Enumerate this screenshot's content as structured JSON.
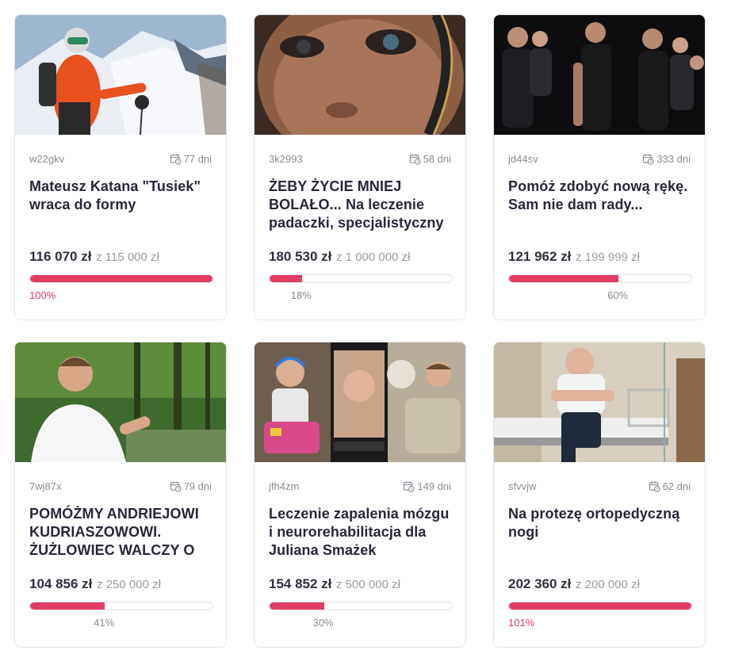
{
  "colors": {
    "accent": "#e23c63",
    "text": "#27273a",
    "muted": "#8a8a96"
  },
  "icons": {
    "days": "calendar-clock-icon"
  },
  "cards": [
    {
      "code": "w22gkv",
      "days": "77 dni",
      "title": "Mateusz Katana \"Tusiek\" wraca do formy",
      "raised": "116 070 zł",
      "goal": "z 115 000 zł",
      "percent_label": "100%",
      "percent": 100,
      "image": "skier on a snowy mountain slope"
    },
    {
      "code": "3k2993",
      "days": "58 dni",
      "title": "ŻEBY ŻYCIE MNIEJ BOLAŁO... Na leczenie padaczki, specjalistyczny",
      "raised": "180 530 zł",
      "goal": "z 1 000 000 zł",
      "percent_label": "18%",
      "percent": 18,
      "image": "close-up of a child's face"
    },
    {
      "code": "jd44sv",
      "days": "333 dni",
      "title": "Pomóż zdobyć nową rękę. Sam nie dam rady...",
      "raised": "121 962 zł",
      "goal": "z 199 999 zł",
      "percent_label": "60%",
      "percent": 60,
      "image": "father with children on black background"
    },
    {
      "code": "7wj87x",
      "days": "79 dni",
      "title": "POMÓŻMY ANDRIEJOWI KUDRIASZOWOWI. ŻUŻLOWIEC WALCZY O",
      "raised": "104 856 zł",
      "goal": "z 250 000 zł",
      "percent_label": "41%",
      "percent": 41,
      "image": "man in white t-shirt in a park"
    },
    {
      "code": "jfh4zm",
      "days": "149 dni",
      "title": "Leczenie zapalenia mózgu i neurorehabilitacja dla Juliana Smażek",
      "raised": "154 852 zł",
      "goal": "z 500 000 zł",
      "percent_label": "30%",
      "percent": 30,
      "image": "collage of a sick child"
    },
    {
      "code": "sfvvjw",
      "days": "62 dni",
      "title": "Na protezę ortopedyczną nogi",
      "raised": "202 360 zł",
      "goal": "z 200 000 zł",
      "percent_label": "101%",
      "percent": 101,
      "image": "man sitting on a hospital bed"
    }
  ]
}
